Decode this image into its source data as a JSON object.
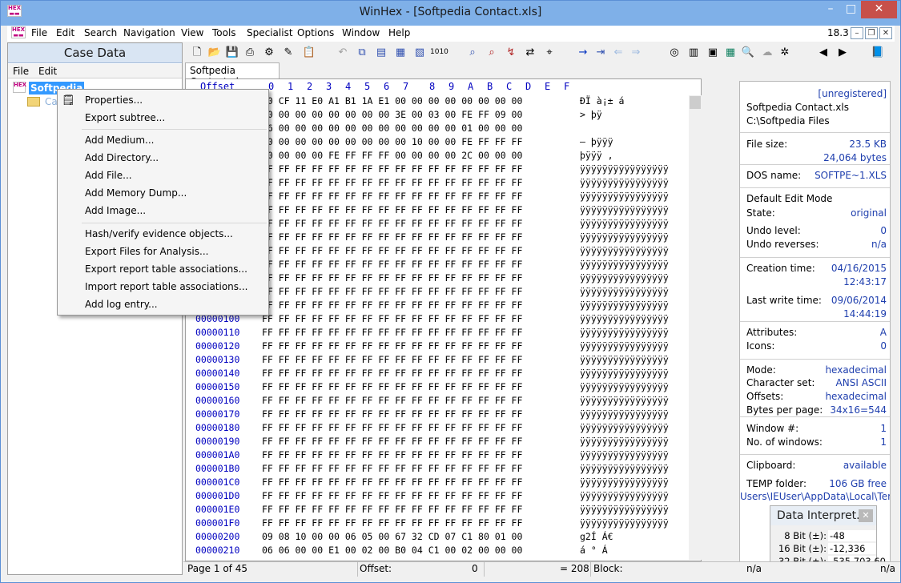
{
  "window": {
    "title": "WinHex - [Softpedia Contact.xls]",
    "version": "18.3"
  },
  "menu": [
    "File",
    "Edit",
    "Search",
    "Navigation",
    "View",
    "Tools",
    "Specialist",
    "Options",
    "Window",
    "Help"
  ],
  "case_panel": {
    "title": "Case Data",
    "menu": [
      "File",
      "Edit"
    ],
    "root": "Softpedia",
    "child": "Ca"
  },
  "context_menu": [
    "Properties...",
    "Export subtree...",
    "Add Medium...",
    "Add Directory...",
    "Add File...",
    "Add Memory Dump...",
    "Add Image...",
    "Hash/verify evidence objects...",
    "Export Files for Analysis...",
    "Export report table associations...",
    "Import report table associations...",
    "Add log entry..."
  ],
  "tab": "Softpedia Contact.xls",
  "hex": {
    "header_offset": "Offset",
    "columns": [
      "0",
      "1",
      "2",
      "3",
      "4",
      "5",
      "6",
      "7",
      "8",
      "9",
      "A",
      "B",
      "C",
      "D",
      "E",
      "F"
    ],
    "rows": [
      {
        "off": "",
        "bytes": "D0 CF 11 E0 A1 B1 1A E1  00 00 00 00 00 00 00 00",
        "ascii": "ÐÏ à¡± á"
      },
      {
        "off": "",
        "bytes": "00 00 00 00 00 00 00 00  3E 00 03 00 FE FF 09 00",
        "ascii": "        >   þÿ"
      },
      {
        "off": "",
        "bytes": "06 00 00 00 00 00 00 00  00 00 00 00 01 00 00 00",
        "ascii": ""
      },
      {
        "off": "",
        "bytes": "00 00 00 00 00 00 00 00  00 10 00 00 FE FF FF FF",
        "ascii": "–          þÿÿÿ"
      },
      {
        "off": "",
        "bytes": "00 00 00 00 FE FF FF FF  00 00 00 00 2C 00 00 00",
        "ascii": "    þÿÿÿ    ,"
      },
      {
        "off": "",
        "bytes": "FF FF FF FF FF FF FF FF  FF FF FF FF FF FF FF FF",
        "ascii": "ÿÿÿÿÿÿÿÿÿÿÿÿÿÿÿÿ"
      },
      {
        "off": "",
        "bytes": "FF FF FF FF FF FF FF FF  FF FF FF FF FF FF FF FF",
        "ascii": "ÿÿÿÿÿÿÿÿÿÿÿÿÿÿÿÿ"
      },
      {
        "off": "",
        "bytes": "FF FF FF FF FF FF FF FF  FF FF FF FF FF FF FF FF",
        "ascii": "ÿÿÿÿÿÿÿÿÿÿÿÿÿÿÿÿ"
      },
      {
        "off": "",
        "bytes": "FF FF FF FF FF FF FF FF  FF FF FF FF FF FF FF FF",
        "ascii": "ÿÿÿÿÿÿÿÿÿÿÿÿÿÿÿÿ"
      },
      {
        "off": "",
        "bytes": "FF FF FF FF FF FF FF FF  FF FF FF FF FF FF FF FF",
        "ascii": "ÿÿÿÿÿÿÿÿÿÿÿÿÿÿÿÿ"
      },
      {
        "off": "",
        "bytes": "FF FF FF FF FF FF FF FF  FF FF FF FF FF FF FF FF",
        "ascii": "ÿÿÿÿÿÿÿÿÿÿÿÿÿÿÿÿ"
      },
      {
        "off": "",
        "bytes": "FF FF FF FF FF FF FF FF  FF FF FF FF FF FF FF FF",
        "ascii": "ÿÿÿÿÿÿÿÿÿÿÿÿÿÿÿÿ"
      },
      {
        "off": "",
        "bytes": "FF FF FF FF FF FF FF FF  FF FF FF FF FF FF FF FF",
        "ascii": "ÿÿÿÿÿÿÿÿÿÿÿÿÿÿÿÿ"
      },
      {
        "off": "",
        "bytes": "FF FF FF FF FF FF FF FF  FF FF FF FF FF FF FF FF",
        "ascii": "ÿÿÿÿÿÿÿÿÿÿÿÿÿÿÿÿ"
      },
      {
        "off": "",
        "bytes": "FF FF FF FF FF FF FF FF  FF FF FF FF FF FF FF FF",
        "ascii": "ÿÿÿÿÿÿÿÿÿÿÿÿÿÿÿÿ"
      },
      {
        "off": "",
        "bytes": "FF FF FF FF FF FF FF FF  FF FF FF FF FF FF FF FF",
        "ascii": "ÿÿÿÿÿÿÿÿÿÿÿÿÿÿÿÿ"
      },
      {
        "off": "00000100",
        "bytes": "FF FF FF FF FF FF FF FF  FF FF FF FF FF FF FF FF",
        "ascii": "ÿÿÿÿÿÿÿÿÿÿÿÿÿÿÿÿ"
      },
      {
        "off": "00000110",
        "bytes": "FF FF FF FF FF FF FF FF  FF FF FF FF FF FF FF FF",
        "ascii": "ÿÿÿÿÿÿÿÿÿÿÿÿÿÿÿÿ"
      },
      {
        "off": "00000120",
        "bytes": "FF FF FF FF FF FF FF FF  FF FF FF FF FF FF FF FF",
        "ascii": "ÿÿÿÿÿÿÿÿÿÿÿÿÿÿÿÿ"
      },
      {
        "off": "00000130",
        "bytes": "FF FF FF FF FF FF FF FF  FF FF FF FF FF FF FF FF",
        "ascii": "ÿÿÿÿÿÿÿÿÿÿÿÿÿÿÿÿ"
      },
      {
        "off": "00000140",
        "bytes": "FF FF FF FF FF FF FF FF  FF FF FF FF FF FF FF FF",
        "ascii": "ÿÿÿÿÿÿÿÿÿÿÿÿÿÿÿÿ"
      },
      {
        "off": "00000150",
        "bytes": "FF FF FF FF FF FF FF FF  FF FF FF FF FF FF FF FF",
        "ascii": "ÿÿÿÿÿÿÿÿÿÿÿÿÿÿÿÿ"
      },
      {
        "off": "00000160",
        "bytes": "FF FF FF FF FF FF FF FF  FF FF FF FF FF FF FF FF",
        "ascii": "ÿÿÿÿÿÿÿÿÿÿÿÿÿÿÿÿ"
      },
      {
        "off": "00000170",
        "bytes": "FF FF FF FF FF FF FF FF  FF FF FF FF FF FF FF FF",
        "ascii": "ÿÿÿÿÿÿÿÿÿÿÿÿÿÿÿÿ"
      },
      {
        "off": "00000180",
        "bytes": "FF FF FF FF FF FF FF FF  FF FF FF FF FF FF FF FF",
        "ascii": "ÿÿÿÿÿÿÿÿÿÿÿÿÿÿÿÿ"
      },
      {
        "off": "00000190",
        "bytes": "FF FF FF FF FF FF FF FF  FF FF FF FF FF FF FF FF",
        "ascii": "ÿÿÿÿÿÿÿÿÿÿÿÿÿÿÿÿ"
      },
      {
        "off": "000001A0",
        "bytes": "FF FF FF FF FF FF FF FF  FF FF FF FF FF FF FF FF",
        "ascii": "ÿÿÿÿÿÿÿÿÿÿÿÿÿÿÿÿ"
      },
      {
        "off": "000001B0",
        "bytes": "FF FF FF FF FF FF FF FF  FF FF FF FF FF FF FF FF",
        "ascii": "ÿÿÿÿÿÿÿÿÿÿÿÿÿÿÿÿ"
      },
      {
        "off": "000001C0",
        "bytes": "FF FF FF FF FF FF FF FF  FF FF FF FF FF FF FF FF",
        "ascii": "ÿÿÿÿÿÿÿÿÿÿÿÿÿÿÿÿ"
      },
      {
        "off": "000001D0",
        "bytes": "FF FF FF FF FF FF FF FF  FF FF FF FF FF FF FF FF",
        "ascii": "ÿÿÿÿÿÿÿÿÿÿÿÿÿÿÿÿ"
      },
      {
        "off": "000001E0",
        "bytes": "FF FF FF FF FF FF FF FF  FF FF FF FF FF FF FF FF",
        "ascii": "ÿÿÿÿÿÿÿÿÿÿÿÿÿÿÿÿ"
      },
      {
        "off": "000001F0",
        "bytes": "FF FF FF FF FF FF FF FF  FF FF FF FF FF FF FF FF",
        "ascii": "ÿÿÿÿÿÿÿÿÿÿÿÿÿÿÿÿ"
      },
      {
        "off": "00000200",
        "bytes": "09 08 10 00 00 06 05 00  67 32 CD 07 C1 80 01 00",
        "ascii": "        g2Í Á€"
      },
      {
        "off": "00000210",
        "bytes": "06 06 00 00 E1 00 02 00  B0 04 C1 00 02 00 00 00",
        "ascii": "    á   ° Á"
      }
    ]
  },
  "info": {
    "unregistered": "[unregistered]",
    "filename": "Softpedia Contact.xls",
    "path": "C:\\Softpedia Files",
    "pairs": [
      {
        "k": "File size:",
        "v": "23.5 KB"
      },
      {
        "k": "",
        "v": "24,064 bytes"
      },
      {
        "k": "DOS name:",
        "v": "SOFTPE~1.XLS"
      },
      {
        "k": "Default Edit Mode",
        "v": ""
      },
      {
        "k": "State:",
        "v": "original"
      },
      {
        "k": "Undo level:",
        "v": "0"
      },
      {
        "k": "Undo reverses:",
        "v": "n/a"
      },
      {
        "k": "Creation time:",
        "v": "04/16/2015"
      },
      {
        "k": "",
        "v": "12:43:17"
      },
      {
        "k": "Last write time:",
        "v": "09/06/2014"
      },
      {
        "k": "",
        "v": "14:44:19"
      },
      {
        "k": "Attributes:",
        "v": "A"
      },
      {
        "k": "Icons:",
        "v": "0"
      },
      {
        "k": "Mode:",
        "v": "hexadecimal"
      },
      {
        "k": "Character set:",
        "v": "ANSI ASCII"
      },
      {
        "k": "Offsets:",
        "v": "hexadecimal"
      },
      {
        "k": "Bytes per page:",
        "v": "34x16=544"
      },
      {
        "k": "Window #:",
        "v": "1"
      },
      {
        "k": "No. of windows:",
        "v": "1"
      },
      {
        "k": "Clipboard:",
        "v": "available"
      },
      {
        "k": "TEMP folder:",
        "v": "106 GB free"
      }
    ],
    "temp_path": "Users\\IEUser\\AppData\\Local\\Temp"
  },
  "data_interpreter": {
    "title": "Data Interpret...",
    "rows": [
      {
        "k": "8 Bit (±):",
        "v": "-48"
      },
      {
        "k": "16 Bit (±):",
        "v": "-12,336"
      },
      {
        "k": "32 Bit (±):",
        "v": "-535,703,60"
      }
    ]
  },
  "status": {
    "page": "Page 1 of 45",
    "offset_label": "Offset:",
    "offset_val": "0",
    "eq": "= 208",
    "block_label": "Block:",
    "block_val": "n/a",
    "tail": "n/a"
  },
  "colors": {
    "accent": "#3399ff",
    "hexblue": "#0000c0",
    "infoblue": "#1f3fae"
  }
}
